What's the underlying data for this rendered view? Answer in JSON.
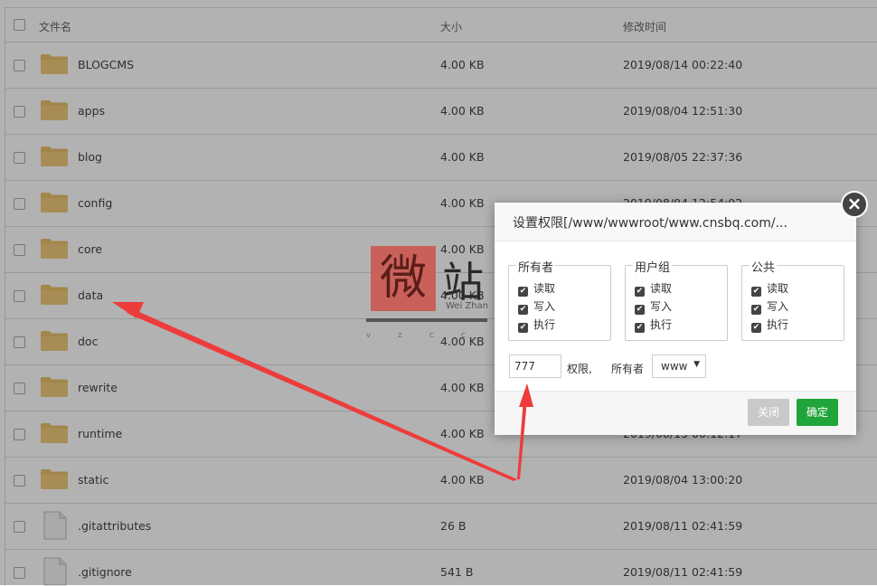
{
  "table": {
    "headers": {
      "name": "文件名",
      "size": "大小",
      "mtime": "修改时间"
    },
    "rows": [
      {
        "name": "BLOGCMS",
        "size": "4.00 KB",
        "mtime": "2019/08/14 00:22:40",
        "type": "folder"
      },
      {
        "name": "apps",
        "size": "4.00 KB",
        "mtime": "2019/08/04 12:51:30",
        "type": "folder"
      },
      {
        "name": "blog",
        "size": "4.00 KB",
        "mtime": "2019/08/05 22:37:36",
        "type": "folder"
      },
      {
        "name": "config",
        "size": "4.00 KB",
        "mtime": "2019/08/04 12:54:02",
        "type": "folder"
      },
      {
        "name": "core",
        "size": "4.00 KB",
        "mtime": "",
        "type": "folder"
      },
      {
        "name": "data",
        "size": "4.00 KB",
        "mtime": "",
        "type": "folder"
      },
      {
        "name": "doc",
        "size": "4.00 KB",
        "mtime": "",
        "type": "folder"
      },
      {
        "name": "rewrite",
        "size": "4.00 KB",
        "mtime": "",
        "type": "folder"
      },
      {
        "name": "runtime",
        "size": "4.00 KB",
        "mtime": "2019/08/15 00:12:17",
        "type": "folder"
      },
      {
        "name": "static",
        "size": "4.00 KB",
        "mtime": "2019/08/04 13:00:20",
        "type": "folder"
      },
      {
        "name": ".gitattributes",
        "size": "26 B",
        "mtime": "2019/08/11 02:41:59",
        "type": "file"
      },
      {
        "name": ".gitignore",
        "size": "541 B",
        "mtime": "2019/08/11 02:41:59",
        "type": "file"
      }
    ]
  },
  "watermark": {
    "char1": "微",
    "char2": "站",
    "en": "Wei Zhan",
    "dots": "V Z C C"
  },
  "dialog": {
    "title": "设置权限[/www/wwwroot/www.cnsbq.com/...",
    "close_symbol": "×",
    "groups": [
      {
        "label": "所有者",
        "read": "读取",
        "write": "写入",
        "exec": "执行"
      },
      {
        "label": "用户组",
        "read": "读取",
        "write": "写入",
        "exec": "执行"
      },
      {
        "label": "公共",
        "read": "读取",
        "write": "写入",
        "exec": "执行"
      }
    ],
    "check_symbol": "✔",
    "perm_value": "777",
    "perm_label": "权限,",
    "owner_label": "所有者",
    "owner_value": "www",
    "owner_arrow": "▼",
    "cancel_label": "关闭",
    "ok_label": "确定"
  },
  "colors": {
    "ok": "#20a53a",
    "cancel": "#c9c9c9",
    "annotation_arrow": "#ee3b3b",
    "folder": "#e8c06a"
  }
}
